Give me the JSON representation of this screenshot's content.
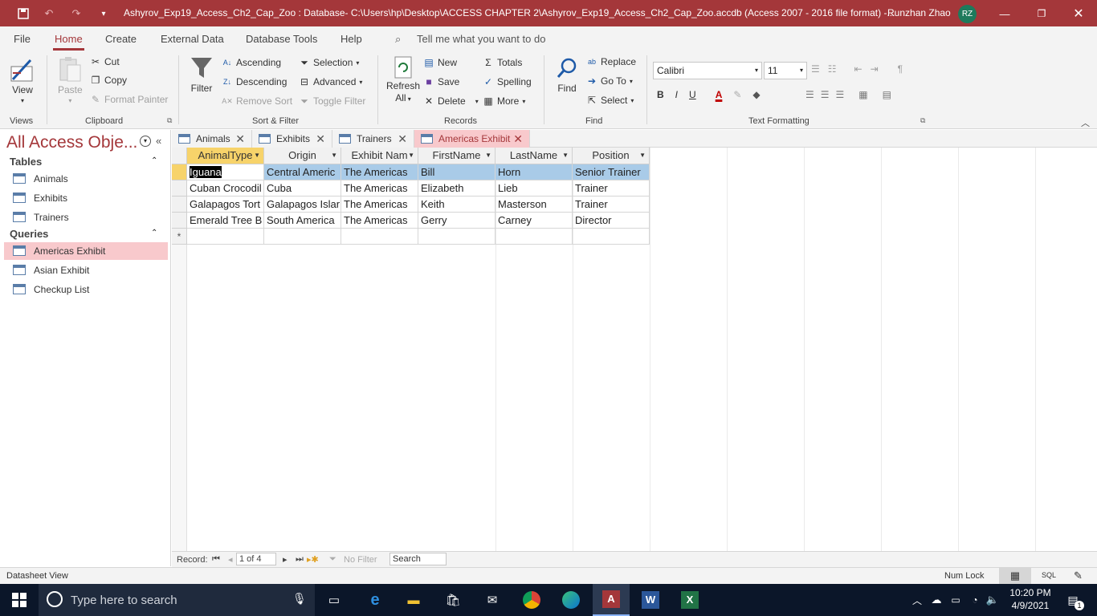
{
  "window": {
    "title": "Ashyrov_Exp19_Access_Ch2_Cap_Zoo : Database- C:\\Users\\hp\\Desktop\\ACCESS CHAPTER 2\\Ashyrov_Exp19_Access_Ch2_Cap_Zoo.accdb (Access 2007 - 2016 file format) -...",
    "user": "Runzhan Zhao",
    "initials": "RZ"
  },
  "ribbon_tabs": [
    "File",
    "Home",
    "Create",
    "External Data",
    "Database Tools",
    "Help"
  ],
  "tell_me": "Tell me what you want to do",
  "ribbon": {
    "views": {
      "view": "View",
      "group": "Views"
    },
    "clipboard": {
      "paste": "Paste",
      "cut": "Cut",
      "copy": "Copy",
      "format_painter": "Format Painter",
      "group": "Clipboard"
    },
    "sort_filter": {
      "filter": "Filter",
      "ascending": "Ascending",
      "descending": "Descending",
      "remove_sort": "Remove Sort",
      "selection": "Selection",
      "advanced": "Advanced",
      "toggle_filter": "Toggle Filter",
      "group": "Sort & Filter"
    },
    "records": {
      "refresh": "Refresh",
      "all": "All",
      "new": "New",
      "save": "Save",
      "delete": "Delete",
      "totals": "Totals",
      "spelling": "Spelling",
      "more": "More",
      "group": "Records"
    },
    "find": {
      "find": "Find",
      "replace": "Replace",
      "goto": "Go To",
      "select": "Select",
      "group": "Find"
    },
    "text": {
      "font": "Calibri",
      "size": "11",
      "group": "Text Formatting"
    }
  },
  "nav": {
    "title": "All Access Obje...",
    "tables_label": "Tables",
    "tables": [
      "Animals",
      "Exhibits",
      "Trainers"
    ],
    "queries_label": "Queries",
    "queries": [
      "Americas Exhibit",
      "Asian Exhibit",
      "Checkup List"
    ]
  },
  "doc_tabs": [
    "Animals",
    "Exhibits",
    "Trainers",
    "Americas Exhibit"
  ],
  "datasheet": {
    "columns": [
      "AnimalType",
      "Origin",
      "Exhibit Nam",
      "FirstName",
      "LastName",
      "Position"
    ],
    "rows": [
      [
        "Iguana",
        "Central Americ",
        "The Americas",
        "Bill",
        "Horn",
        "Senior Trainer"
      ],
      [
        "Cuban Crocodil",
        "Cuba",
        "The Americas",
        "Elizabeth",
        "Lieb",
        "Trainer"
      ],
      [
        "Galapagos Tort",
        "Galapagos Islar",
        "The Americas",
        "Keith",
        "Masterson",
        "Trainer"
      ],
      [
        "Emerald Tree B",
        "South America",
        "The Americas",
        "Gerry",
        "Carney",
        "Director"
      ]
    ],
    "new_row_marker": "*"
  },
  "record_nav": {
    "label": "Record:",
    "position": "1 of 4",
    "filter": "No Filter",
    "search": "Search"
  },
  "status": {
    "view": "Datasheet View",
    "numlock": "Num Lock",
    "sql": "SQL"
  },
  "taskbar": {
    "search_placeholder": "Type here to search",
    "time": "10:20 PM",
    "date": "4/9/2021",
    "notif_count": "1"
  },
  "colors": {
    "accent": "#a4373a",
    "selected_header": "#f7d36a",
    "row_highlight": "#a9cbe8",
    "tab_active": "#f8c9cc",
    "taskbar": "#0b1629"
  }
}
